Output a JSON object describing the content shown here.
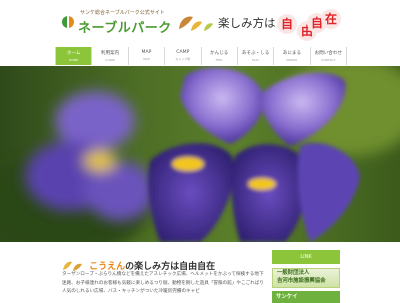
{
  "header": {
    "tagline": "サンケ総合ネーブルパーク公式サイト",
    "logo_text": "ネーブルパーク",
    "slogan": "楽しみ方は",
    "slogan_circles": [
      "自",
      "由",
      "自",
      "在"
    ]
  },
  "nav": {
    "items": [
      {
        "label": "ホーム",
        "sub": "HOME"
      },
      {
        "label": "利用案内",
        "sub": "GUIDE"
      },
      {
        "label": "MAP",
        "sub": "MAP"
      },
      {
        "label": "CAMP",
        "sub": "キャンプ場"
      },
      {
        "label": "かんじる",
        "sub": "FEEL"
      },
      {
        "label": "あそぶ・しる",
        "sub": "PLAY"
      },
      {
        "label": "あにまる",
        "sub": "ANIMAL"
      },
      {
        "label": "お問い合わせ",
        "sub": "CONTACT"
      }
    ]
  },
  "content": {
    "title_highlight": "こうえん",
    "title_rest": "の楽しみ方は自由自在",
    "body": "ターザンロープ・ぶらりん橋などを備えたアスレチック広場、ヘルメットをかぶって探検する地下迷路、お子様連れのお客様も気軽に楽しめるつり堀、動物を飼した遊具「冒険の館」やこごればり人気のしれるい広場、バス・キッチンがついた冷暖房完備のキャビ"
  },
  "sidebar": {
    "link_header": "LINK",
    "banner1_lines": [
      "一般財団法人",
      "吉河市施設振興協会"
    ],
    "banner2": "サンケイ"
  },
  "colors": {
    "nav_active": "#8cc43a",
    "logo_green": "#4a9b32",
    "accent_orange": "#e8820f",
    "circle_red": "#e0232a"
  }
}
